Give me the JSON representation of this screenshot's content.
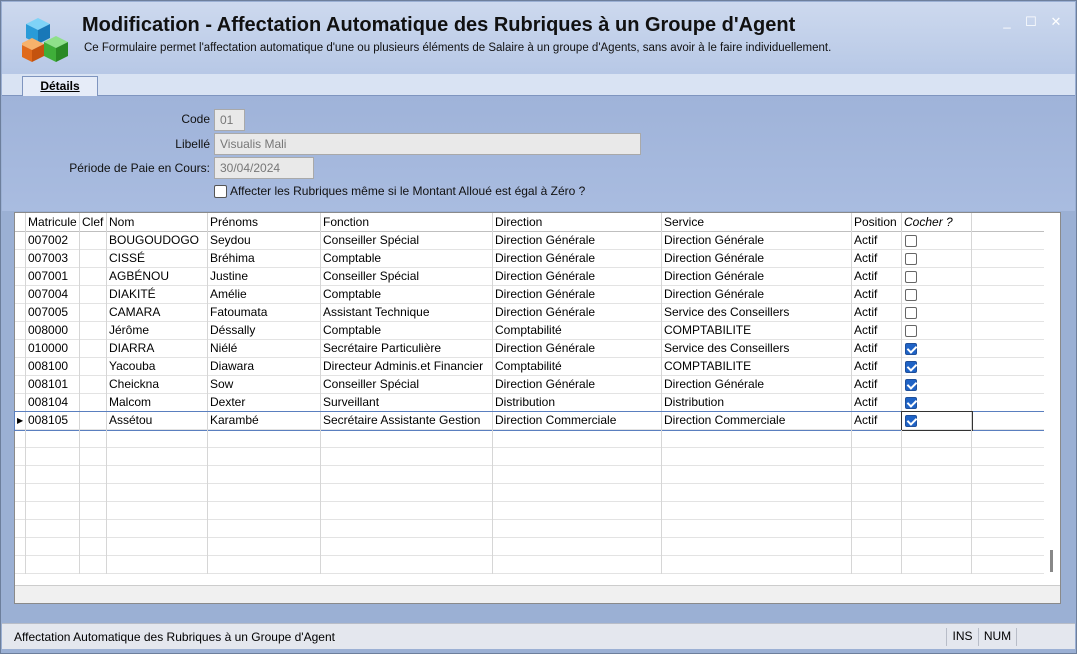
{
  "window": {
    "title": "Modification - Affectation Automatique des Rubriques à un Groupe d'Agent",
    "subtitle": "Ce Formulaire permet l'affectation automatique d'une ou plusieurs éléments de Salaire à un groupe d'Agents, sans avoir à le faire individuellement.",
    "minimize_label": "_",
    "maximize_label": "☐",
    "close_label": "✕"
  },
  "tabs": [
    {
      "label": "Détails"
    }
  ],
  "form": {
    "code_label": "Code",
    "code_value": "01",
    "libelle_label": "Libellé",
    "libelle_value": "Visualis Mali",
    "periode_label": "Période de Paie en Cours:",
    "periode_value": "30/04/2024",
    "checkbox_label": "Affecter les Rubriques même si le Montant Alloué est égal à Zéro ?"
  },
  "grid": {
    "columns": [
      "Matricule",
      "Clef",
      "Nom",
      "Prénoms",
      "Fonction",
      "Direction",
      "Service",
      "Position",
      "Cocher ?"
    ],
    "rows": [
      {
        "matricule": "007002",
        "clef": "",
        "nom": "BOUGOUDOGO",
        "prenoms": "Seydou",
        "fonction": "Conseiller Spécial",
        "direction": "Direction Générale",
        "service": "Direction Générale",
        "position": "Actif",
        "checked": false
      },
      {
        "matricule": "007003",
        "clef": "",
        "nom": "CISSÉ",
        "prenoms": "Bréhima",
        "fonction": "Comptable",
        "direction": "Direction Générale",
        "service": "Direction Générale",
        "position": "Actif",
        "checked": false
      },
      {
        "matricule": "007001",
        "clef": "",
        "nom": "AGBÉNOU",
        "prenoms": "Justine",
        "fonction": "Conseiller Spécial",
        "direction": "Direction Générale",
        "service": "Direction Générale",
        "position": "Actif",
        "checked": false
      },
      {
        "matricule": "007004",
        "clef": "",
        "nom": "DIAKITÉ",
        "prenoms": "Amélie",
        "fonction": "Comptable",
        "direction": "Direction Générale",
        "service": "Direction Générale",
        "position": "Actif",
        "checked": false
      },
      {
        "matricule": "007005",
        "clef": "",
        "nom": "CAMARA",
        "prenoms": "Fatoumata",
        "fonction": "Assistant Technique",
        "direction": "Direction Générale",
        "service": "Service des Conseillers",
        "position": "Actif",
        "checked": false
      },
      {
        "matricule": "008000",
        "clef": "",
        "nom": "Jérôme",
        "prenoms": "Déssally",
        "fonction": "Comptable",
        "direction": "Comptabilité",
        "service": "COMPTABILITE",
        "position": "Actif",
        "checked": false
      },
      {
        "matricule": "010000",
        "clef": "",
        "nom": "DIARRA",
        "prenoms": "Niélé",
        "fonction": "Secrétaire Particulière",
        "direction": "Direction Générale",
        "service": "Service des Conseillers",
        "position": "Actif",
        "checked": true
      },
      {
        "matricule": "008100",
        "clef": "",
        "nom": "Yacouba",
        "prenoms": "Diawara",
        "fonction": "Directeur Adminis.et Financier",
        "direction": "Comptabilité",
        "service": "COMPTABILITE",
        "position": "Actif",
        "checked": true
      },
      {
        "matricule": "008101",
        "clef": "",
        "nom": "Cheickna",
        "prenoms": "Sow",
        "fonction": "Conseiller Spécial",
        "direction": "Direction Générale",
        "service": "Direction Générale",
        "position": "Actif",
        "checked": true
      },
      {
        "matricule": "008104",
        "clef": "",
        "nom": "Malcom",
        "prenoms": "Dexter",
        "fonction": "Surveillant",
        "direction": "Distribution",
        "service": "Distribution",
        "position": "Actif",
        "checked": true
      },
      {
        "matricule": "008105",
        "clef": "",
        "nom": "Assétou",
        "prenoms": "Karambé",
        "fonction": "Secrétaire Assistante  Gestion",
        "direction": "Direction Commerciale",
        "service": "Direction Commerciale",
        "position": "Actif",
        "checked": true,
        "selected": true
      }
    ]
  },
  "statusbar": {
    "text": "Affectation Automatique des Rubriques à un Groupe d'Agent",
    "ins": "INS",
    "num": "NUM"
  }
}
